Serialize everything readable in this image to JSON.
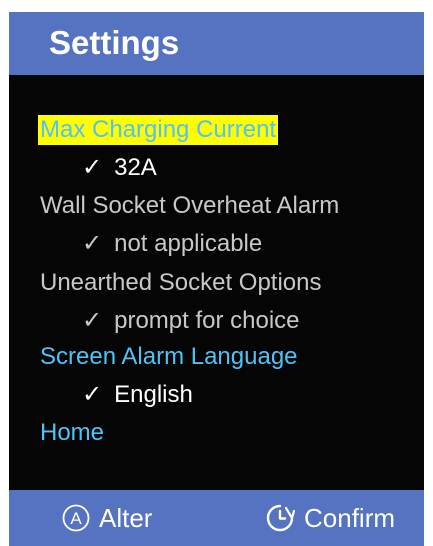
{
  "header": {
    "title": "Settings"
  },
  "menu": {
    "items": [
      {
        "label": "Max Charging Current",
        "selected_value": "32A",
        "label_color": "#4fc3f7",
        "highlighted": true,
        "highlight_color": "#ffff00"
      },
      {
        "label": "Wall Socket Overheat Alarm",
        "selected_value": "not applicable",
        "label_color": "#c8c8c8"
      },
      {
        "label": "Unearthed Socket Options",
        "selected_value": "prompt for choice",
        "label_color": "#c8c8c8"
      },
      {
        "label": "Screen Alarm Language",
        "selected_value": "English",
        "label_color": "#4fc3f7"
      },
      {
        "label": "Home",
        "label_color": "#4fc3f7"
      }
    ],
    "check_glyph": "✓"
  },
  "footer": {
    "alter": {
      "icon": "a-circle-icon",
      "label": "Alter"
    },
    "confirm": {
      "icon": "clock-arrow-icon",
      "label": "Confirm"
    }
  },
  "colors": {
    "header_bg": "#5673c1",
    "screen_bg": "#050505",
    "accent_text": "#4fc3f7",
    "muted_text": "#c8c8c8",
    "value_text": "#ffffff",
    "highlight": "#ffff00"
  }
}
